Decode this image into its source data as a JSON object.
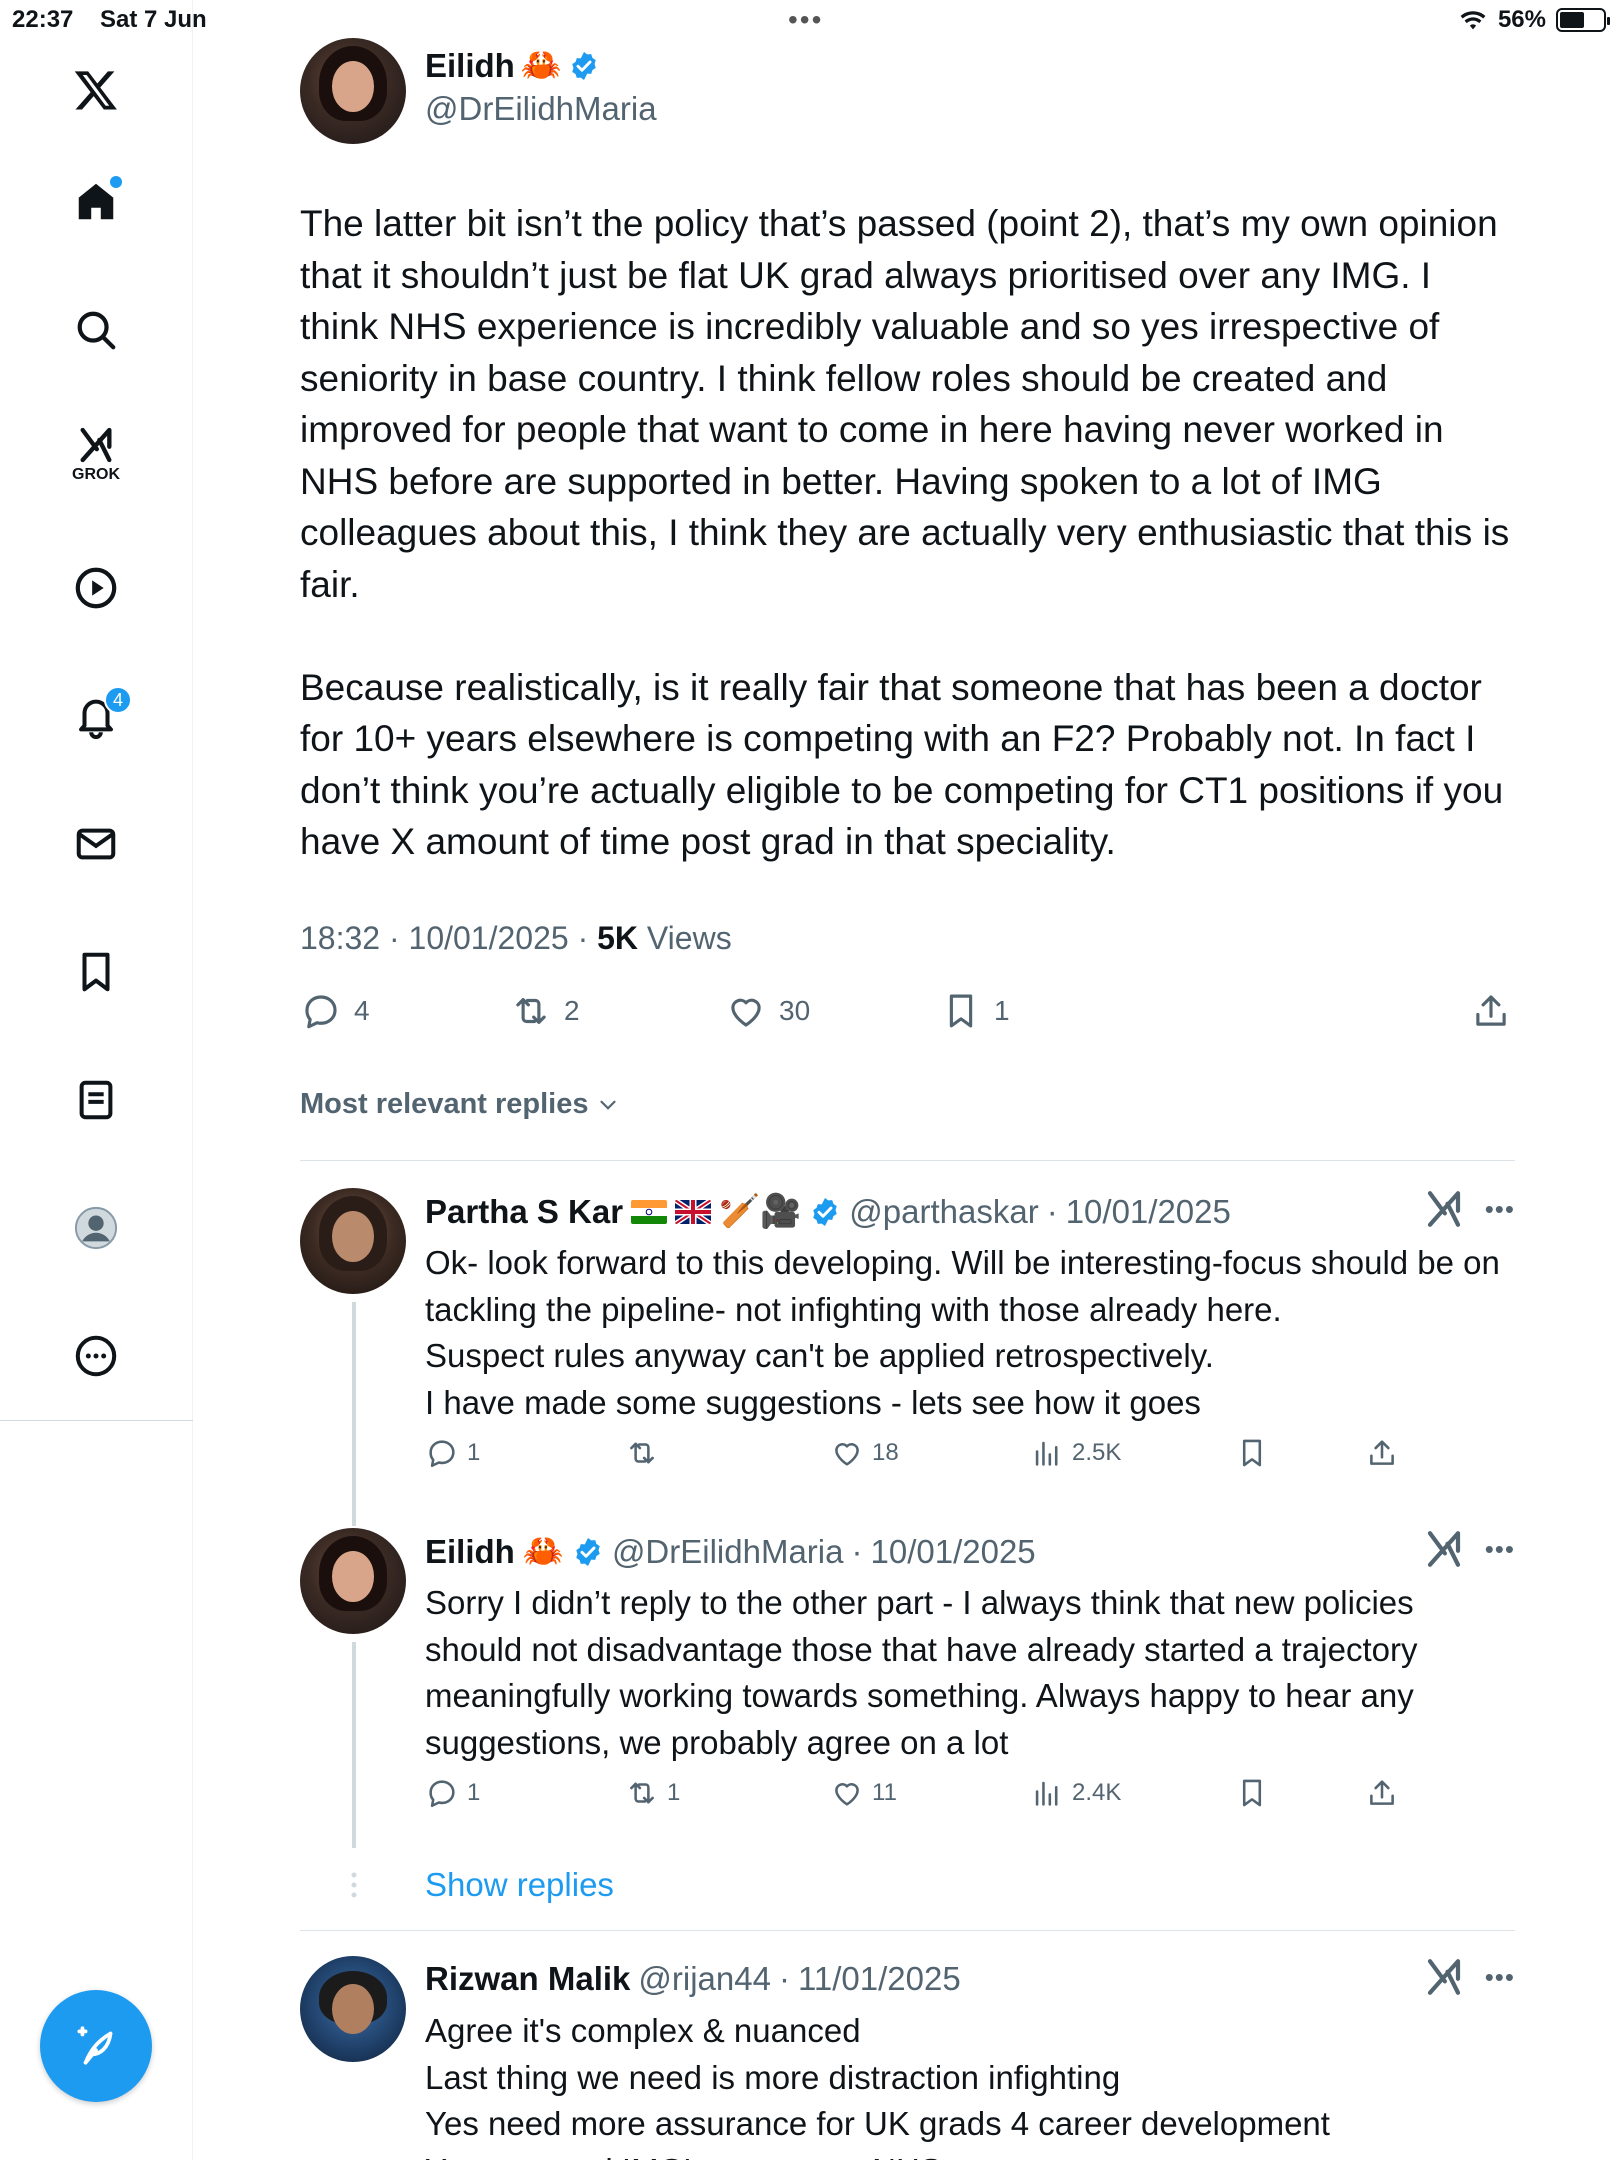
{
  "status_bar": {
    "time": "22:37",
    "date": "Sat 7 Jun",
    "battery": "56%",
    "battery_level": 0.56
  },
  "sidebar": {
    "grok_label": "GROK",
    "notifications_count": "4"
  },
  "tweet": {
    "author_name": "Eilidh",
    "author_emoji": "🦀",
    "author_handle": "@DrEilidhMaria",
    "text": "The latter bit isn’t the policy that’s passed (point 2), that’s my own opinion that it shouldn’t just be flat UK grad always prioritised over any IMG. I think NHS experience is incredibly valuable and so yes irrespective of seniority in base country. I think fellow roles should be created and improved for people that want to come in here having never worked in NHS before are supported in better. Having spoken to a lot of IMG colleagues about this, I think they are actually very enthusiastic that this is fair.\n\nBecause realistically, is it really fair that someone that has been a doctor for 10+ years elsewhere is competing with an F2? Probably not. In fact I don’t think you’re actually eligible to be competing for CT1 positions if you have X amount of time post grad in that speciality.",
    "time": "18:32",
    "date": "10/01/2025",
    "views_count": "5K",
    "views_label": "Views",
    "replies": "4",
    "reposts": "2",
    "likes": "30",
    "bookmarks": "1"
  },
  "replies_sort": "Most relevant replies",
  "replies": [
    {
      "name": "Partha S Kar",
      "emoji_suffix": "🏏🎥",
      "handle": "@parthaskar",
      "date": "10/01/2025",
      "text": "Ok- look forward to this developing. Will be interesting-focus should be on tackling the pipeline- not infighting with those already here.\nSuspect rules anyway can't be applied retrospectively.\nI have made some suggestions - lets see how it goes",
      "replies": "1",
      "reposts": "",
      "likes": "18",
      "views": "2.5K"
    },
    {
      "name": "Eilidh",
      "emoji_suffix": "🦀",
      "handle": "@DrEilidhMaria",
      "date": "10/01/2025",
      "text": "Sorry I didn’t reply to the other part - I always think that new policies should not disadvantage those that have already started a trajectory meaningfully working towards something. Always happy to hear any suggestions, we probably agree on a lot",
      "replies": "1",
      "reposts": "1",
      "likes": "11",
      "views": "2.4K"
    },
    {
      "name": "Rizwan Malik",
      "emoji_suffix": "",
      "handle": "@rijan44",
      "date": "11/01/2025",
      "text": "Agree it's complex & nuanced\nLast thing we need is more distraction infighting\nYes need more assurance for UK grads 4 career development\nYes we need IMG's to support NHS"
    }
  ],
  "show_replies": "Show replies",
  "colors": {
    "accent": "#1d9bf0",
    "muted": "#536471",
    "text": "#0f1419"
  }
}
